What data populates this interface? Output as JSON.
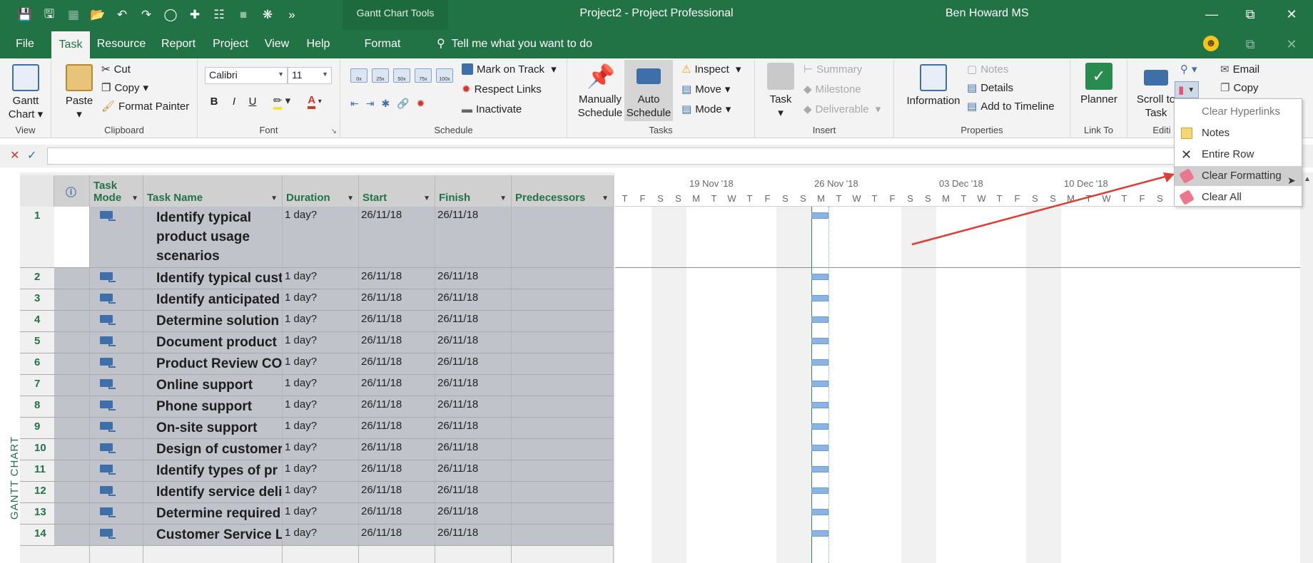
{
  "window": {
    "contextual_tab_group": "Gantt Chart Tools",
    "title": "Project2  -  Project Professional",
    "user": "Ben Howard MS"
  },
  "menu": {
    "tabs": [
      "File",
      "Task",
      "Resource",
      "Report",
      "Project",
      "View",
      "Help",
      "Format"
    ],
    "active": "Task",
    "tell_me": "Tell me what you want to do"
  },
  "ribbon": {
    "view": {
      "gantt_label": "Gantt Chart",
      "group": "View"
    },
    "clipboard": {
      "paste": "Paste",
      "cut": "Cut",
      "copy": "Copy",
      "format_painter": "Format Painter",
      "group": "Clipboard"
    },
    "font": {
      "family": "Calibri",
      "size": "11",
      "group": "Font"
    },
    "schedule": {
      "mark_on_track": "Mark on Track",
      "respect_links": "Respect Links",
      "inactivate": "Inactivate",
      "group": "Schedule",
      "pct": [
        "0x",
        "25x",
        "50x",
        "75x",
        "100x"
      ]
    },
    "tasks": {
      "manually": "Manually Schedule",
      "auto": "Auto Schedule",
      "inspect": "Inspect",
      "move": "Move",
      "mode": "Mode",
      "group": "Tasks"
    },
    "insert": {
      "task": "Task",
      "summary": "Summary",
      "milestone": "Milestone",
      "deliverable": "Deliverable",
      "group": "Insert"
    },
    "properties": {
      "information": "Information",
      "notes": "Notes",
      "details": "Details",
      "add_to_timeline": "Add to Timeline",
      "group": "Properties"
    },
    "link_to": {
      "planner": "Planner",
      "group": "Link To"
    },
    "editing": {
      "scroll_to_task": "Scroll to Task",
      "group": "Editi",
      "email": "Email",
      "copy": "Copy"
    }
  },
  "table": {
    "columns": [
      "Task Mode",
      "Task Name",
      "Duration",
      "Start",
      "Finish",
      "Predecessors"
    ],
    "rows": [
      {
        "id": "1",
        "name": "Identify typical product usage scenarios",
        "duration": "1 day?",
        "start": "26/11/18",
        "finish": "26/11/18"
      },
      {
        "id": "2",
        "name": "Identify typical cust",
        "duration": "1 day?",
        "start": "26/11/18",
        "finish": "26/11/18"
      },
      {
        "id": "3",
        "name": "Identify anticipated",
        "duration": "1 day?",
        "start": "26/11/18",
        "finish": "26/11/18"
      },
      {
        "id": "4",
        "name": "Determine solution",
        "duration": "1 day?",
        "start": "26/11/18",
        "finish": "26/11/18"
      },
      {
        "id": "5",
        "name": "Document product",
        "duration": "1 day?",
        "start": "26/11/18",
        "finish": "26/11/18"
      },
      {
        "id": "6",
        "name": "Product Review CO",
        "duration": "1 day?",
        "start": "26/11/18",
        "finish": "26/11/18"
      },
      {
        "id": "7",
        "name": "Online support",
        "duration": "1 day?",
        "start": "26/11/18",
        "finish": "26/11/18"
      },
      {
        "id": "8",
        "name": "Phone support",
        "duration": "1 day?",
        "start": "26/11/18",
        "finish": "26/11/18"
      },
      {
        "id": "9",
        "name": "On-site support",
        "duration": "1 day?",
        "start": "26/11/18",
        "finish": "26/11/18"
      },
      {
        "id": "10",
        "name": "Design of customer",
        "duration": "1 day?",
        "start": "26/11/18",
        "finish": "26/11/18"
      },
      {
        "id": "11",
        "name": "Identify types of pr",
        "duration": "1 day?",
        "start": "26/11/18",
        "finish": "26/11/18"
      },
      {
        "id": "12",
        "name": "Identify service deli",
        "duration": "1 day?",
        "start": "26/11/18",
        "finish": "26/11/18"
      },
      {
        "id": "13",
        "name": "Determine required",
        "duration": "1 day?",
        "start": "26/11/18",
        "finish": "26/11/18"
      },
      {
        "id": "14",
        "name": "Customer Service Le",
        "duration": "1 day?",
        "start": "26/11/18",
        "finish": "26/11/18"
      }
    ]
  },
  "timeline": {
    "weeks": [
      "19 Nov '18",
      "26 Nov '18",
      "03 Dec '18",
      "10 Dec '18"
    ],
    "days": [
      "T",
      "F",
      "S",
      "S",
      "M",
      "T",
      "W",
      "T",
      "F",
      "S",
      "S",
      "M",
      "T",
      "W",
      "T",
      "F",
      "S",
      "S",
      "M",
      "T",
      "W",
      "T",
      "F",
      "S",
      "S",
      "M",
      "T",
      "W",
      "T",
      "F",
      "S"
    ]
  },
  "view_label": "GANTT CHART",
  "dropdown": {
    "items": [
      "Clear Hyperlinks",
      "Notes",
      "Entire Row",
      "Clear Formatting",
      "Clear All"
    ],
    "highlighted": "Clear Formatting"
  },
  "colors": {
    "accent": "#217346",
    "row_fill": "#c1c3cb",
    "bar": "#8ab4e3",
    "arrow": "#e03c31"
  }
}
